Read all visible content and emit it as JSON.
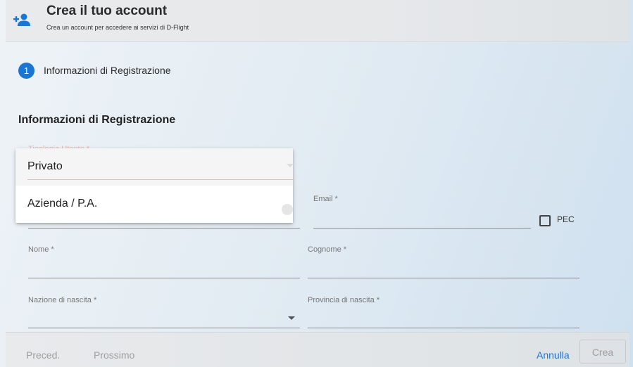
{
  "header": {
    "title": "Crea il tuo account",
    "subtitle": "Crea un account per accedere ai servizi di D-Flight",
    "icon": "add-user-icon"
  },
  "stepper": {
    "step_number": "1",
    "step_label": "Informazioni di Registrazione"
  },
  "form": {
    "section_title": "Informazioni di Registrazione",
    "tipologia_label": "Tipologia Utente *",
    "tipologia_options": [
      "Privato",
      "Azienda / P.A."
    ],
    "tipologia_selected": "Privato",
    "email_label": "Email *",
    "pec_label": "PEC",
    "nome_label": "Nome *",
    "cognome_label": "Cognome *",
    "nazione_label": "Nazione di nascita *",
    "provincia_label": "Provincia di nascita *"
  },
  "footer": {
    "prev_label": "Preced.",
    "next_label": "Prossimo",
    "cancel_label": "Annulla",
    "create_label": "Crea"
  },
  "colors": {
    "primary": "#1976d2",
    "required_label": "#e5533d"
  }
}
